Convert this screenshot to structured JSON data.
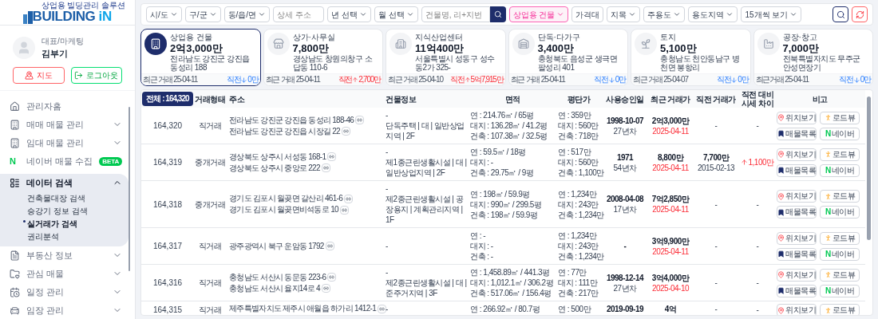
{
  "logo": {
    "tagline": "상업용 빌딩관리 솔루션",
    "name": "BUILDING",
    "suffix": "iN"
  },
  "profile": {
    "role": "대표/마케팅",
    "name": "김부기",
    "buttons": [
      {
        "kind": "map",
        "label": "지도"
      },
      {
        "kind": "logout",
        "label": "로그아웃"
      }
    ]
  },
  "menu": [
    {
      "label": "관리자홈"
    },
    {
      "label": "매매 매물 관리",
      "expanded": false
    },
    {
      "label": "임대 매물 관리",
      "expanded": false
    },
    {
      "icon_text": "N",
      "label": "네이버 매물 수집",
      "badge": "BETA"
    },
    {
      "label": "데이터 검색",
      "expanded": true,
      "children": [
        {
          "label": "건축물대장 검색",
          "selected": false
        },
        {
          "label": "승강기 정보 검색",
          "selected": false
        },
        {
          "label": "실거래가 검색",
          "selected": true
        },
        {
          "label": "권리분석",
          "selected": false
        }
      ]
    },
    {
      "label": "부동산 정보",
      "expanded": false
    },
    {
      "label": "관심 매물",
      "expanded": false
    },
    {
      "label": "일정 관리",
      "expanded": false
    },
    {
      "label": "임장 관리",
      "expanded": false
    }
  ],
  "filters": [
    {
      "kind": "select",
      "label": "시/도",
      "active": false
    },
    {
      "kind": "select",
      "label": "구/군",
      "active": false
    },
    {
      "kind": "select",
      "label": "동/읍/면",
      "active": false
    },
    {
      "kind": "input",
      "placeholder": "상세 주소"
    },
    {
      "kind": "select",
      "label": "년 선택",
      "active": false
    },
    {
      "kind": "select",
      "label": "월 선택",
      "active": false
    },
    {
      "kind": "search",
      "placeholder": "건물명, 리+지번"
    },
    {
      "kind": "select",
      "label": "상업용 건물",
      "active": true
    },
    {
      "kind": "button",
      "label": "가격대"
    },
    {
      "kind": "select",
      "label": "지목",
      "active": false
    },
    {
      "kind": "select",
      "label": "주용도",
      "active": false
    },
    {
      "kind": "select",
      "label": "용도지역",
      "active": false
    },
    {
      "kind": "select",
      "label": "15개씩 보기",
      "active": false
    }
  ],
  "cards": [
    {
      "selected": true,
      "category": "상업용 건물",
      "price": "2억3,000만",
      "address": "전라남도 강진군 강진읍 동성리 188",
      "recent": "최근 거래 25-04-11",
      "change_label": "직전",
      "change": "0만",
      "rising": false
    },
    {
      "selected": false,
      "category": "상가·사무실",
      "price": "7,800만",
      "address": "경상남도 창원의창구 소답동 110-6",
      "recent": "최근 거래 25-04-11",
      "change_label": "직전",
      "change": "2,700만",
      "rising": true
    },
    {
      "selected": false,
      "category": "지식산업센터",
      "price": "11억400만",
      "address": "서울특별시 성동구 성수동2가 325-",
      "recent": "최근 거래 25-04-10",
      "change_label": "직전",
      "change": "5억7,915만",
      "rising": true
    },
    {
      "selected": false,
      "category": "단독·다가구",
      "price": "3,400만",
      "address": "충청북도 음성군 생극면 팔성리 401",
      "recent": "최근 거래 25-04-11",
      "change_label": "직전",
      "change": "0만",
      "rising": false
    },
    {
      "selected": false,
      "category": "토지",
      "price": "5,100만",
      "address": "충청남도 천안동남구 병천면 봉항리",
      "recent": "최근 거래 25-04-07",
      "change_label": "직전",
      "change": "0만",
      "rising": false
    },
    {
      "selected": false,
      "category": "공장·창고",
      "price": "7,000만",
      "address": "전북특별자치도 무주군 안성면장기",
      "recent": "최근거래 25-04-11",
      "change_label": "직전",
      "change": "0만",
      "rising": false
    }
  ],
  "table": {
    "total": "전체 : 164,320",
    "columns": [
      "거래형태",
      "주소",
      "건물정보",
      "면적",
      "평단가",
      "사용승인일",
      "최근 거래가",
      "직전 거래가",
      "직전 대비 시세 차이",
      "비고"
    ],
    "rows": [
      {
        "no": "164,320",
        "deal": "직거래",
        "addresses": [
          "전라남도 강진군 강진읍 동성리 188-46",
          "전라남도 강진군 강진읍 시장길 22"
        ],
        "building": [
          "-",
          "단독주택 | 대 | 일반상업지역 | 2F"
        ],
        "area": [
          "연 : 214.76㎡ / 65평",
          "대지 : 136.28㎡ / 41.2평",
          "건축 : 107.38㎡ / 32.5평"
        ],
        "unit": [
          "연 : 359만",
          "대지 : 560만",
          "건축 : 718만"
        ],
        "approval": [
          "1998-10-07",
          "27년차"
        ],
        "recent": {
          "price": "2억3,000만",
          "date": "2025-04-11"
        },
        "prev": [
          "-"
        ],
        "diff": {
          "rising": false,
          "value": "-"
        },
        "actions": [
          {
            "kind": "map",
            "label": "위치보기"
          },
          {
            "kind": "roadview",
            "label": "로드뷰"
          },
          {
            "kind": "list",
            "label": "매물목록"
          },
          {
            "kind": "naver",
            "label": "네이버",
            "mark": "N"
          }
        ]
      },
      {
        "no": "164,319",
        "deal": "중개거래",
        "addresses": [
          "경상북도 상주시 서성동 168-1",
          "경상북도 상주시 중앙로 222"
        ],
        "building": [
          "-",
          "제1종근린생활시설 | 대 | 일반상업지역 | 2F"
        ],
        "area": [
          "연 : 59.5㎡ / 18평",
          "대지 : -",
          "건축 : 29.75㎡ / 9평"
        ],
        "unit": [
          "연 : 517만",
          "대지 : 560만",
          "건축 : 1,100만"
        ],
        "approval": [
          "1971",
          "54년차"
        ],
        "recent": {
          "price": "8,800만",
          "date": "2025-04-11"
        },
        "prev": [
          "7,700만",
          "2015-02-13"
        ],
        "diff": {
          "rising": true,
          "value": "1,100만"
        },
        "actions": [
          {
            "kind": "map",
            "label": "위치보기"
          },
          {
            "kind": "roadview",
            "label": "로드뷰"
          },
          {
            "kind": "list",
            "label": "매물목록"
          },
          {
            "kind": "naver",
            "label": "네이버",
            "mark": "N"
          }
        ]
      },
      {
        "no": "164,318",
        "deal": "중개거래",
        "addresses": [
          "경기도 김포시 월곶면 갈산리 461-6",
          "경기도 김포시 월곶면비석동로 10"
        ],
        "building": [
          "-",
          "제2종근린생활시설 | 공장용지 | 계획관리지역 | 1F"
        ],
        "area": [
          "연 : 198㎡ / 59.9평",
          "대지 : 990㎡ / 299.5평",
          "건축 : 198㎡ / 59.9평"
        ],
        "unit": [
          "연 : 1,234만",
          "대지 : 243만",
          "건축 : 1,234만"
        ],
        "approval": [
          "2008-04-08",
          "17년차"
        ],
        "recent": {
          "price": "7억2,850만",
          "date": "2025-04-11"
        },
        "prev": [
          "-"
        ],
        "diff": {
          "rising": false,
          "value": "-"
        },
        "actions": [
          {
            "kind": "map",
            "label": "위치보기"
          },
          {
            "kind": "roadview",
            "label": "로드뷰"
          },
          {
            "kind": "list",
            "label": "매물목록"
          },
          {
            "kind": "naver",
            "label": "네이버",
            "mark": "N"
          }
        ]
      },
      {
        "no": "164,317",
        "deal": "직거래",
        "addresses": [
          "광주광역시 북구 운암동 1792"
        ],
        "building": [
          "-"
        ],
        "area": [
          "연 : -",
          "대지 : -",
          "건축 : -"
        ],
        "unit": [
          "연 : 1,234만",
          "대지 : 243만",
          "건축 : 1,234만"
        ],
        "approval": [
          "-"
        ],
        "recent": {
          "price": "3억9,900만",
          "date": "2025-04-11"
        },
        "prev": [
          "-"
        ],
        "diff": {
          "rising": false,
          "value": "-"
        },
        "actions": [
          {
            "kind": "map",
            "label": "위치보기"
          },
          {
            "kind": "roadview",
            "label": "로드뷰"
          },
          {
            "kind": "list",
            "label": "매물목록"
          },
          {
            "kind": "naver",
            "label": "네이버",
            "mark": "N"
          }
        ]
      },
      {
        "no": "164,316",
        "deal": "직거래",
        "addresses": [
          "충청남도 서산시 동문동 223-6",
          "충청남도 서산시 율지14로 4"
        ],
        "building": [
          "-",
          "제2종근린생활시설 | 대 | 준주거지역 | 3F"
        ],
        "area": [
          "연 : 1,458.89㎡ / 441.3평",
          "대지 : 1,012.1㎡ / 306.2평",
          "건축 : 517.06㎡ / 156.4평"
        ],
        "unit": [
          "연 : 77만",
          "대지 : 111만",
          "건축 : 217만"
        ],
        "approval": [
          "1998-12-14",
          "27년차"
        ],
        "recent": {
          "price": "3억4,000만",
          "date": "2025-04-10"
        },
        "prev": [
          "-"
        ],
        "diff": {
          "rising": false,
          "value": "-"
        },
        "actions": [
          {
            "kind": "map",
            "label": "위치보기"
          },
          {
            "kind": "roadview",
            "label": "로드뷰"
          },
          {
            "kind": "list",
            "label": "매물목록"
          },
          {
            "kind": "naver",
            "label": "네이버",
            "mark": "N"
          }
        ]
      },
      {
        "no": "164,315",
        "deal": "직거래",
        "addresses": [
          "제주특별자치도 제주시 애월읍 하가리 1412-1"
        ],
        "building": [
          "-"
        ],
        "area": [
          "연 : 266.92㎡ / 80.7평"
        ],
        "unit": [
          "연 : 500만"
        ],
        "approval": [
          "2019-09-19"
        ],
        "recent": {
          "price": "4억"
        },
        "prev": [
          "-"
        ],
        "diff": {
          "rising": false,
          "value": "-"
        },
        "actions": [
          {
            "kind": "map",
            "label": "위치보기"
          },
          {
            "kind": "roadview",
            "label": "로드뷰"
          }
        ]
      }
    ]
  }
}
